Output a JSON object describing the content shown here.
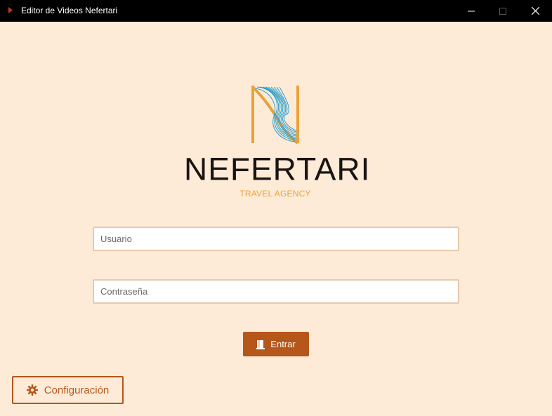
{
  "window": {
    "title": "Editor de Videos Nefertari",
    "controls": [
      "minimize-icon",
      "maximize-icon",
      "close-icon"
    ]
  },
  "branding": {
    "name": "NEFERTARI",
    "tagline": "TRAVEL AGENCY",
    "logo_icon": "nefertari-n-logo"
  },
  "login": {
    "username_placeholder": "Usuario",
    "username_value": "",
    "password_placeholder": "Contraseña",
    "password_value": "",
    "submit_label": "Entrar",
    "submit_icon": "door-icon"
  },
  "footer": {
    "config_label": "Configuración",
    "config_icon": "gear-icon"
  },
  "colors": {
    "background": "#fdebd8",
    "titlebar": "#000000",
    "accent": "#b5561b",
    "brand_orange": "#e8a23a",
    "brand_blue": "#2a9fd0",
    "field_border": "#e5c9ad"
  }
}
